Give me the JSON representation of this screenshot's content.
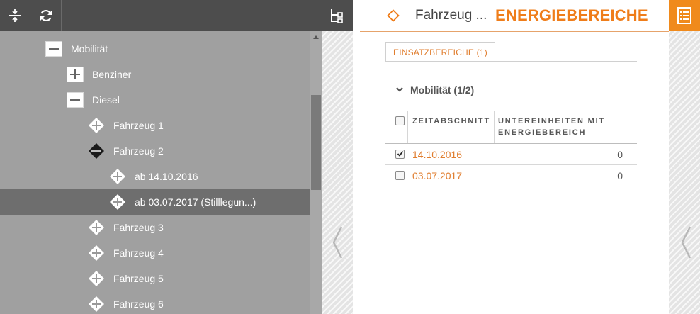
{
  "toolbar": {
    "collapse_icon": "collapse-all-icon",
    "refresh_icon": "refresh-icon",
    "hierarchy_icon": "hierarchy-icon"
  },
  "tree": {
    "items": [
      {
        "label": "Mobilität",
        "icon": "minus",
        "level": 0
      },
      {
        "label": "Benziner",
        "icon": "plus",
        "level": 1
      },
      {
        "label": "Diesel",
        "icon": "minus",
        "level": 1
      },
      {
        "label": "Fahrzeug 1",
        "icon": "diamond-plus",
        "level": 2
      },
      {
        "label": "Fahrzeug 2",
        "icon": "diamond-minus",
        "level": 2
      },
      {
        "label": "ab 14.10.2016",
        "icon": "diamond-plus",
        "level": 3
      },
      {
        "label": "ab 03.07.2017 (Stilllegun...)",
        "icon": "diamond-plus",
        "level": 3,
        "selected": true
      },
      {
        "label": "Fahrzeug 3",
        "icon": "diamond-plus",
        "level": 2
      },
      {
        "label": "Fahrzeug 4",
        "icon": "diamond-plus",
        "level": 2
      },
      {
        "label": "Fahrzeug 5",
        "icon": "diamond-plus",
        "level": 2
      },
      {
        "label": "Fahrzeug 6",
        "icon": "diamond-plus",
        "level": 2
      }
    ]
  },
  "header": {
    "breadcrumb": "Fahrzeug ...",
    "title": "ENERGIEBEREICHE"
  },
  "tabs": [
    {
      "label": "EINSATZBEREICHE (1)",
      "active": true
    }
  ],
  "section": {
    "label": "Mobilität (1/2)",
    "expanded": true
  },
  "table": {
    "columns": [
      "ZEITABSCHNITT",
      "UNTEREINHEITEN MIT",
      "ENERGIEBEREICH"
    ],
    "rows": [
      {
        "checked": true,
        "date": "14.10.2016",
        "count": "0"
      },
      {
        "checked": false,
        "date": "03.07.2017",
        "count": "0"
      }
    ]
  },
  "colors": {
    "accent": "#ef7d1a",
    "toolbar": "#4d4d4d",
    "tree_bg": "#a0a0a0",
    "tree_selected": "#6e6e6e"
  }
}
